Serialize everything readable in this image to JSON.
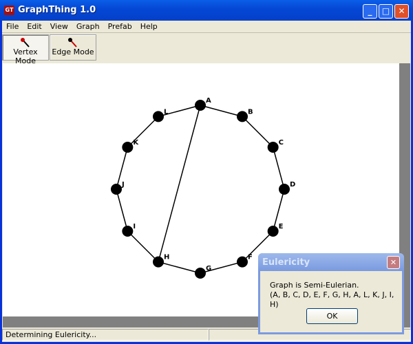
{
  "window": {
    "title": "GraphThing 1.0",
    "icon_text": "GT"
  },
  "menu": [
    "File",
    "Edit",
    "View",
    "Graph",
    "Prefab",
    "Help"
  ],
  "toolbar": {
    "vertex_mode": "Vertex Mode",
    "edge_mode": "Edge Mode"
  },
  "graph": {
    "vertices": [
      "A",
      "B",
      "C",
      "D",
      "E",
      "F",
      "G",
      "H",
      "I",
      "J",
      "K",
      "L"
    ],
    "edges": [
      [
        "A",
        "B"
      ],
      [
        "B",
        "C"
      ],
      [
        "C",
        "D"
      ],
      [
        "D",
        "E"
      ],
      [
        "E",
        "F"
      ],
      [
        "F",
        "G"
      ],
      [
        "G",
        "H"
      ],
      [
        "H",
        "I"
      ],
      [
        "I",
        "J"
      ],
      [
        "J",
        "K"
      ],
      [
        "K",
        "L"
      ],
      [
        "L",
        "A"
      ],
      [
        "A",
        "H"
      ]
    ]
  },
  "status": {
    "text": "Determining Eulericity..."
  },
  "dialog": {
    "title": "Eulericity",
    "line1": "Graph is Semi-Eulerian.",
    "line2": "(A, B, C, D, E, F, G, H, A, L, K, J, I, H)",
    "ok": "OK"
  },
  "colors": {
    "title_bar": "#0548d6",
    "node": "#000000",
    "accent": "#cc0000"
  }
}
